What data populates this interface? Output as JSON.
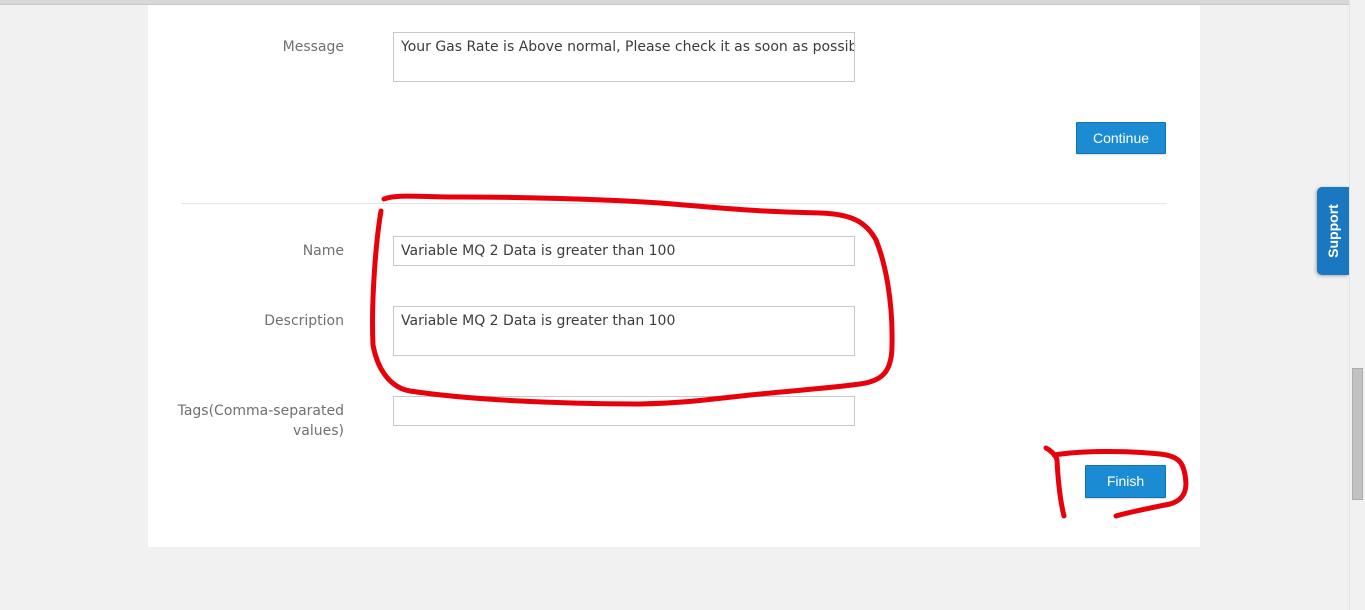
{
  "form": {
    "message": {
      "label": "Message",
      "value": "Your Gas Rate is Above normal, Please check it as soon as possible."
    },
    "continue_label": "Continue",
    "name": {
      "label": "Name",
      "value": "Variable MQ 2 Data is greater than 100"
    },
    "description": {
      "label": "Description",
      "value": "Variable MQ 2 Data is greater than 100"
    },
    "tags": {
      "label_line1": "Tags(Comma-separated",
      "label_line2": "values)",
      "value": ""
    },
    "finish_label": "Finish"
  },
  "support_tab": {
    "label": "Support"
  },
  "colors": {
    "button_blue": "#1b8cd4",
    "support_blue": "#1a78c2",
    "annotation_red": "#e8000b",
    "page_background": "#f1f1f1"
  }
}
